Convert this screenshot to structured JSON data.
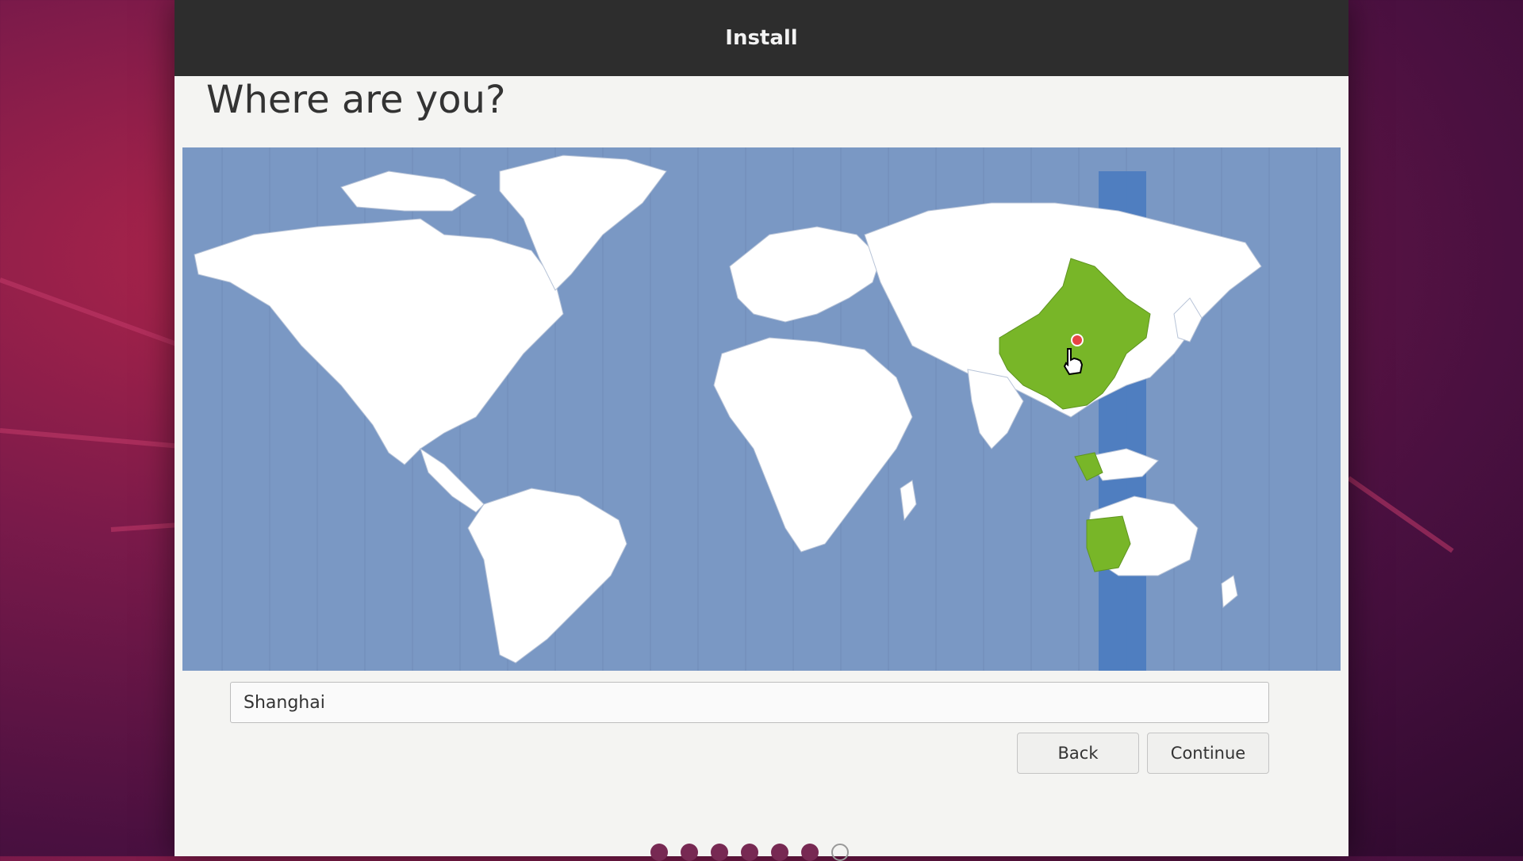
{
  "window": {
    "title": "Install"
  },
  "page": {
    "heading": "Where are you?"
  },
  "location": {
    "value": "Shanghai"
  },
  "buttons": {
    "back": "Back",
    "continue": "Continue"
  },
  "progress": {
    "completed_steps": 6,
    "total_steps_visible": 7
  },
  "colors": {
    "ocean": "#7a98c4",
    "land": "#ffffff",
    "selected_zone": "#78b628",
    "highlight_band": "#4a7bc0",
    "marker": "#e64545",
    "progress_dot": "#772953"
  },
  "icons": [
    "pointer-hand-cursor",
    "location-marker"
  ]
}
